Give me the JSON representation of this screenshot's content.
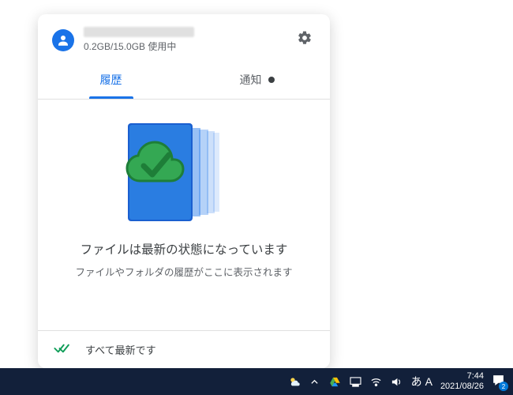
{
  "header": {
    "storage_text": "0.2GB/15.0GB 使用中"
  },
  "tabs": {
    "history": "履歴",
    "notifications": "通知"
  },
  "content": {
    "title": "ファイルは最新の状態になっています",
    "subtitle": "ファイルやフォルダの履歴がここに表示されます"
  },
  "footer": {
    "status": "すべて最新です"
  },
  "taskbar": {
    "ime1": "あ",
    "ime2": "A",
    "time": "7:44",
    "date": "2021/08/26",
    "badge": "2"
  }
}
